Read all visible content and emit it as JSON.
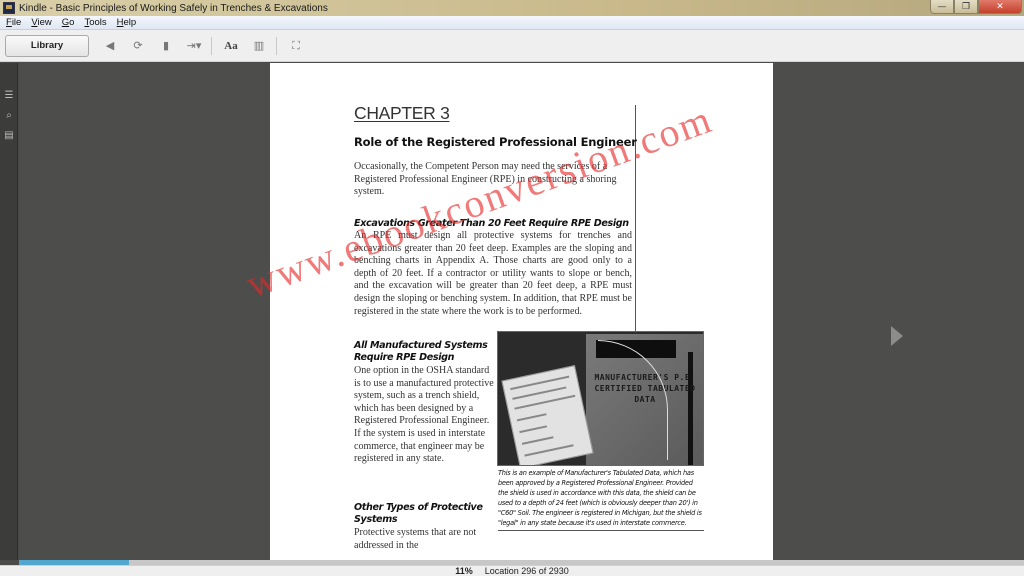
{
  "window": {
    "title": "Kindle - Basic Principles of Working Safely in Trenches & Excavations",
    "controls": {
      "minimize": "—",
      "restore": "❐",
      "close": "✕"
    }
  },
  "menu": [
    "File",
    "View",
    "Go",
    "Tools",
    "Help"
  ],
  "toolbar": {
    "library_label": "Library",
    "icons": {
      "back": "◀",
      "sync": "⟳",
      "bookmark": "▮",
      "goto": "⇥▾",
      "font": "Aa",
      "columns": "▥",
      "fullscreen": "⛶"
    }
  },
  "left_rail": {
    "icons": {
      "toc": "☰",
      "search": "⌕",
      "notes": "▤"
    }
  },
  "page": {
    "chapter": "CHAPTER 3",
    "heading": "Role of the Registered Professional Engineer",
    "intro": "Occasionally, the Competent Person may need the services of a Registered Professional Engineer (RPE) in constructing a shoring system.",
    "sections": [
      {
        "heading": "Excavations Greater Than 20 Feet Require RPE Design",
        "body": "An RPE must design all protective systems for trenches and excavations greater than 20 feet deep. Examples are the sloping and benching charts in Appendix A. Those charts are good only to a depth of 20 feet. If a contractor or utility wants to slope or bench, and the excavation will be greater than 20 feet deep, a RPE must design the sloping or benching system. In addition, that RPE must be registered in the state where the work is to be performed."
      },
      {
        "heading": "All Manufactured Systems Require RPE Design",
        "body": "One option in the OSHA standard is to use a manufactured protective system, such as a trench shield, which has been designed by a Registered Professional Engineer. If the system is used in interstate commerce, that engineer may be registered in any state."
      },
      {
        "heading": "Other Types of Protective Systems",
        "body": "Protective systems that are not addressed in the"
      }
    ],
    "figure": {
      "label": "MANUFACTURER'S P.E. CERTIFIED TABULATED DATA",
      "caption": "This is an example of Manufacturer's Tabulated Data, which has been approved by a Registered Professional Engineer. Provided the shield is used in accordance with this data, the shield can be used to a depth of 24 feet (which is obviously deeper than 20') in \"C60\" Soil. The engineer is registered in Michigan, but the shield is \"legal\" in any state because it's used in interstate commerce."
    }
  },
  "watermark": "www.ebookconversion.com",
  "navigation": {
    "next_page_icon": "next-page-arrow"
  },
  "status": {
    "progress_percent_label": "11%",
    "progress_fraction": 0.11,
    "location": "Location 296 of 2930"
  },
  "colors": {
    "progress_fill": "#52a7cf",
    "watermark": "#e62828",
    "reading_bg": "#4d4d4b"
  }
}
